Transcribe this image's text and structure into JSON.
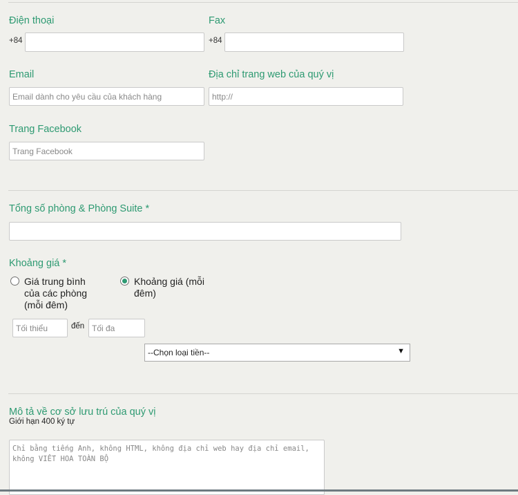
{
  "contact": {
    "phone": {
      "label": "Điện thoại",
      "prefix": "+84",
      "value": ""
    },
    "fax": {
      "label": "Fax",
      "prefix": "+84",
      "value": ""
    },
    "email": {
      "label": "Email",
      "placeholder": "Email dành cho yêu cầu của khách hàng"
    },
    "website": {
      "label": "Địa chỉ trang web của quý vị",
      "placeholder": "http://"
    },
    "facebook": {
      "label": "Trang Facebook",
      "placeholder": "Trang Facebook"
    }
  },
  "rooms": {
    "label": "Tổng số phòng & Phòng Suite *",
    "value": ""
  },
  "price": {
    "label": "Khoảng giá *",
    "options": [
      {
        "line1": "Giá trung bình",
        "line2": "của các phòng",
        "line3": "(mỗi đêm)",
        "selected": false
      },
      {
        "line1": "Khoảng giá (mỗi",
        "line2": "đêm)",
        "selected": true
      }
    ],
    "min_placeholder": "Tối thiểu",
    "to_label": "đến",
    "max_placeholder": "Tối đa",
    "currency_selected": "--Chọn loại tiền--"
  },
  "description": {
    "label": "Mô tả về cơ sở lưu trú của quý vị",
    "limit": "Giới hạn 400 ký tự",
    "placeholder": "Chỉ bằng tiếng Anh, không HTML, không địa chỉ web hay địa chỉ email, không VIẾT HOA TOÀN BỘ"
  },
  "colors": {
    "label_green": "#2e9a72",
    "background": "#f0f0ec"
  }
}
